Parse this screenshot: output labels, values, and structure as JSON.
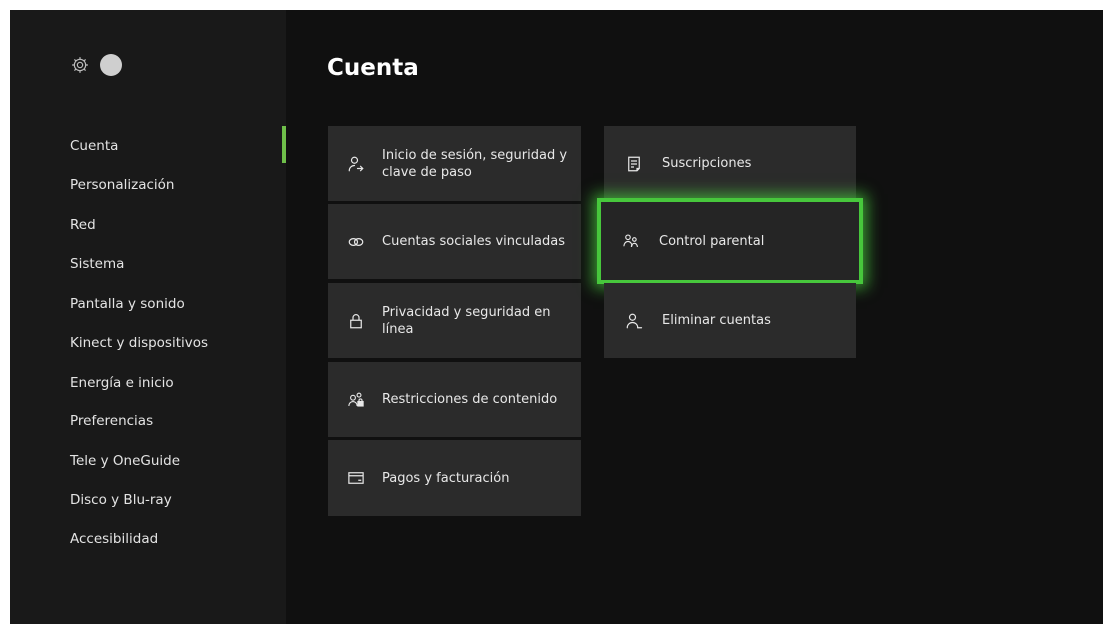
{
  "page": {
    "title": "Cuenta"
  },
  "sidebar": {
    "items": [
      {
        "label": "Cuenta",
        "active": true
      },
      {
        "label": "Personalización"
      },
      {
        "label": "Red"
      },
      {
        "label": "Sistema"
      },
      {
        "label": "Pantalla y sonido"
      },
      {
        "label": "Kinect y dispositivos"
      },
      {
        "label": "Energía e inicio"
      },
      {
        "label": "Preferencias"
      },
      {
        "label": "Tele y OneGuide"
      },
      {
        "label": "Disco y Blu-ray"
      },
      {
        "label": "Accesibilidad"
      }
    ]
  },
  "tiles": {
    "col1": [
      {
        "label": "Inicio de sesión, seguridad y clave de paso",
        "icon": "person-sign-in-icon"
      },
      {
        "label": "Cuentas sociales vinculadas",
        "icon": "linked-rings-icon"
      },
      {
        "label": "Privacidad y seguridad en línea",
        "icon": "lock-icon"
      },
      {
        "label": "Restricciones de contenido",
        "icon": "people-lock-icon"
      },
      {
        "label": "Pagos y facturación",
        "icon": "credit-card-icon"
      }
    ],
    "col2": [
      {
        "label": "Suscripciones",
        "icon": "subscriptions-icon"
      },
      {
        "label": "Control parental",
        "icon": "family-icon",
        "focused": true
      },
      {
        "label": "Eliminar cuentas",
        "icon": "remove-person-icon"
      }
    ]
  },
  "colors": {
    "background": "#101010",
    "sidebar": "#191919",
    "tile": "#2b2b2b",
    "focus": "#47c73c",
    "active_indicator": "#6fbf4a"
  }
}
